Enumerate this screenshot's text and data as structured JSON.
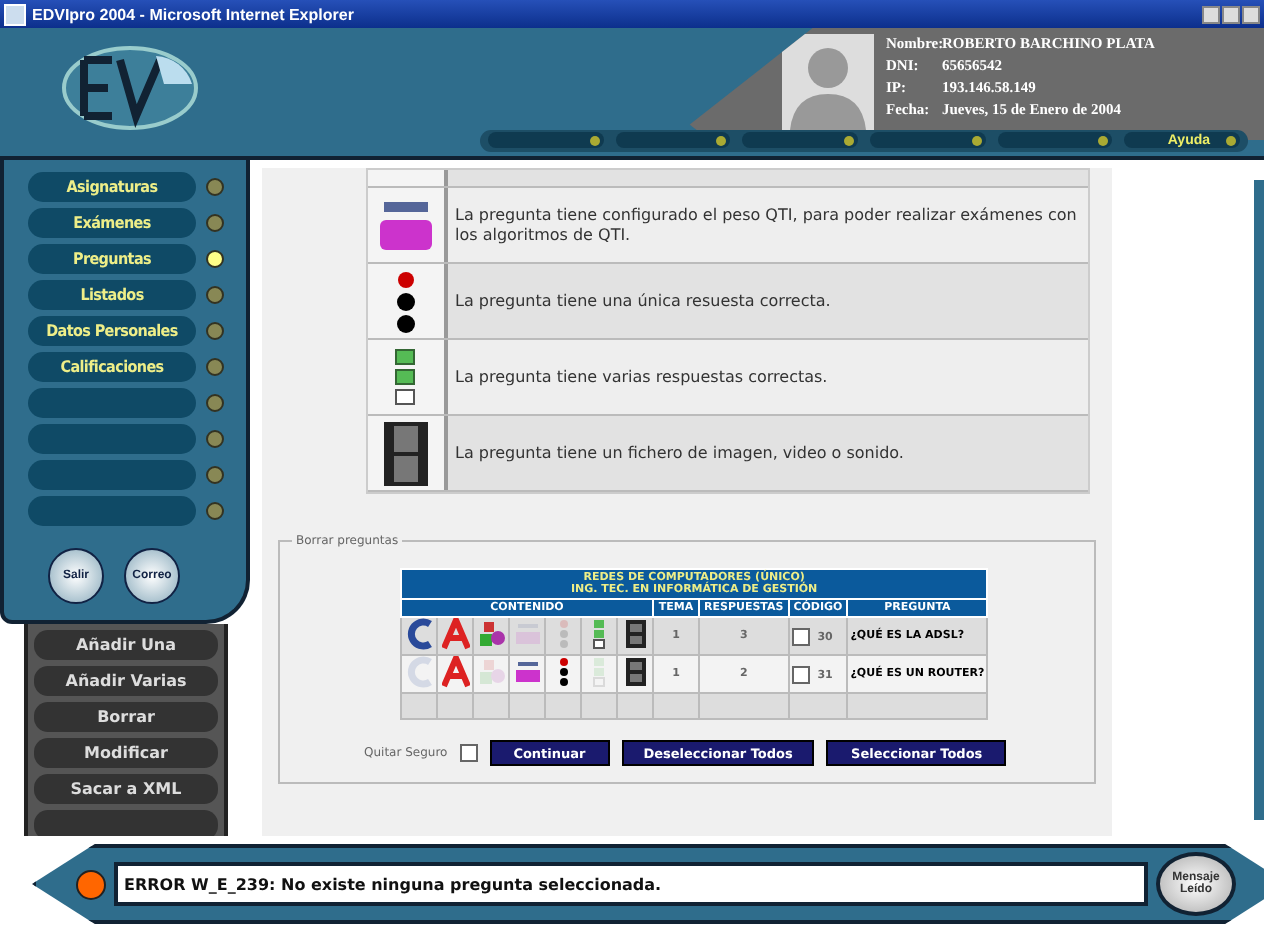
{
  "window": {
    "title": "EDVIpro 2004 - Microsoft Internet Explorer"
  },
  "user": {
    "fields": [
      {
        "label": "Nombre:",
        "value": "ROBERTO BARCHINO PLATA"
      },
      {
        "label": "DNI:",
        "value": "65656542"
      },
      {
        "label": "IP:",
        "value": "193.146.58.149"
      },
      {
        "label": "Fecha:",
        "value": "Jueves, 15 de Enero de 2004"
      }
    ]
  },
  "top_nav": {
    "help": "Ayuda"
  },
  "sidebar": {
    "items": [
      {
        "label": "Asignaturas",
        "selected": false
      },
      {
        "label": "Exámenes",
        "selected": false
      },
      {
        "label": "Preguntas",
        "selected": true
      },
      {
        "label": "Listados",
        "selected": false
      },
      {
        "label": "Datos Personales",
        "selected": false
      },
      {
        "label": "Calificaciones",
        "selected": false
      }
    ],
    "round_buttons": [
      "Salir",
      "Correo"
    ],
    "actions": [
      "Añadir Una",
      "Añadir Varias",
      "Borrar",
      "Modificar",
      "Sacar a XML"
    ]
  },
  "legend": [
    {
      "kind": "qti",
      "text": "La pregunta tiene configurado el peso QTI, para poder realizar exámenes con los algoritmos de QTI."
    },
    {
      "kind": "single",
      "text": "La pregunta tiene una única resuesta correcta."
    },
    {
      "kind": "multi",
      "text": "La pregunta tiene varias respuestas correctas."
    },
    {
      "kind": "media",
      "text": "La pregunta tiene un fichero de imagen, video o sonido."
    }
  ],
  "delete_panel": {
    "legend": "Borrar preguntas",
    "table": {
      "title": [
        "REDES DE COMPUTADORES (ÚNICO)",
        "ING. TEC. EN INFORMÁTICA DE GESTIÓN"
      ],
      "columns": [
        "CONTENIDO",
        "TEMA",
        "RESPUESTAS",
        "CÓDIGO",
        "PREGUNTA"
      ],
      "rows": [
        {
          "icons": [
            {
              "kind": "c",
              "on": true
            },
            {
              "kind": "a",
              "on": true
            },
            {
              "kind": "image",
              "on": true
            },
            {
              "kind": "qti",
              "on": false
            },
            {
              "kind": "single",
              "on": false
            },
            {
              "kind": "multi",
              "on": true
            },
            {
              "kind": "media",
              "on": true
            }
          ],
          "tema": "1",
          "respuestas": "3",
          "checked": false,
          "codigo": "30",
          "pregunta": "¿QUÉ ES LA ADSL?"
        },
        {
          "icons": [
            {
              "kind": "c",
              "on": false
            },
            {
              "kind": "a",
              "on": true
            },
            {
              "kind": "image",
              "on": false
            },
            {
              "kind": "qti",
              "on": true
            },
            {
              "kind": "single",
              "on": true
            },
            {
              "kind": "multi",
              "on": false
            },
            {
              "kind": "media",
              "on": true
            }
          ],
          "tema": "1",
          "respuestas": "2",
          "checked": false,
          "codigo": "31",
          "pregunta": "¿QUÉ ES UN ROUTER?"
        }
      ]
    },
    "safety": {
      "label": "Quitar Seguro",
      "checked": false
    },
    "buttons": [
      "Continuar",
      "Deseleccionar Todos",
      "Seleccionar Todos"
    ]
  },
  "status": {
    "message": "ERROR W_E_239: No existe ninguna pregunta seleccionada.",
    "button": "Mensaje Leído"
  }
}
